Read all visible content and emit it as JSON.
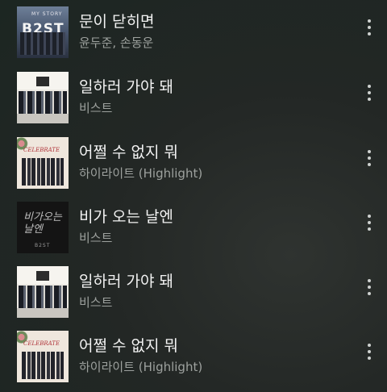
{
  "songs": [
    {
      "title": "문이 닫히면",
      "artist": "윤두준, 손동운",
      "art": "mystory",
      "art_top": "MY STORY",
      "art_logo": "B2ST"
    },
    {
      "title": "일하러 가야 돼",
      "artist": "비스트",
      "art": "dumbfool",
      "art_top": "",
      "art_logo": ""
    },
    {
      "title": "어쩔 수 없지 뭐",
      "artist": "하이라이트 (Highlight)",
      "art": "celebrate",
      "art_top": "CELEBRATE",
      "art_logo": ""
    },
    {
      "title": "비가 오는 날엔",
      "artist": "비스트",
      "art": "rainy",
      "art_top": "비가오는 날엔",
      "art_logo": "B2ST"
    },
    {
      "title": "일하러 가야 돼",
      "artist": "비스트",
      "art": "dumbfool",
      "art_top": "",
      "art_logo": ""
    },
    {
      "title": "어쩔 수 없지 뭐",
      "artist": "하이라이트 (Highlight)",
      "art": "celebrate",
      "art_top": "CELEBRATE",
      "art_logo": ""
    }
  ],
  "icons": {
    "more": "more-vert-icon"
  },
  "colors": {
    "title": "#f2f2f2",
    "artist": "#9da19e",
    "background": "#232725"
  }
}
